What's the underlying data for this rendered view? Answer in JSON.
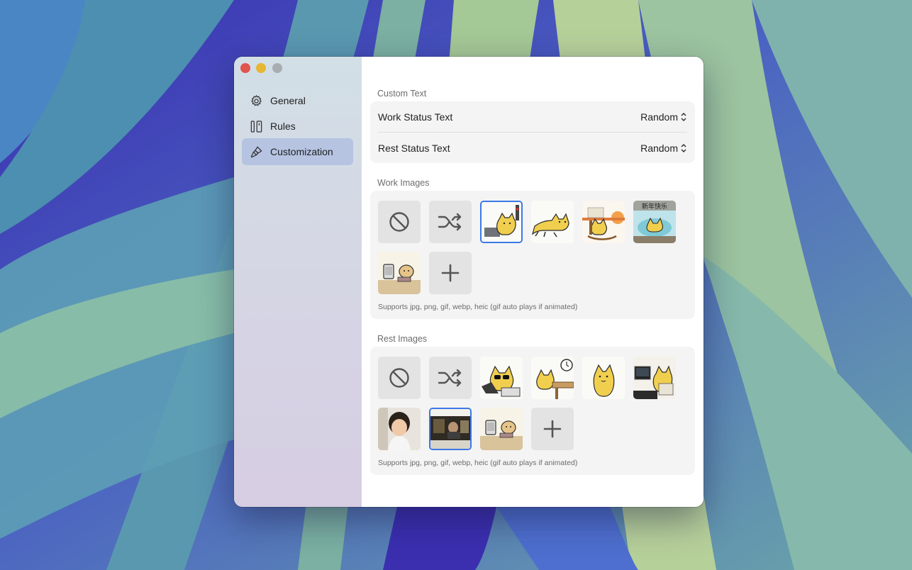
{
  "window": {
    "sidebar": {
      "items": [
        {
          "label": "General",
          "icon": "gear-icon"
        },
        {
          "label": "Rules",
          "icon": "rules-icon"
        },
        {
          "label": "Customization",
          "icon": "brush-icon",
          "selected": true
        }
      ]
    },
    "custom_text": {
      "title": "Custom Text",
      "rows": [
        {
          "label": "Work Status Text",
          "value": "Random"
        },
        {
          "label": "Rest Status Text",
          "value": "Random"
        }
      ]
    },
    "work_images": {
      "title": "Work Images",
      "tiles": [
        "none-icon",
        "shuffle-icon",
        "cat-laptop-image",
        "cat-running-image",
        "cat-rocking-chair-image",
        "cat-bath-image",
        "dog-computer-image",
        "add-icon"
      ],
      "selected_index": 2,
      "hint": "Supports jpg, png, gif, webp, heic (gif auto plays if animated)"
    },
    "rest_images": {
      "title": "Rest Images",
      "tiles": [
        "none-icon",
        "shuffle-icon",
        "cat-sunglasses-image",
        "cat-clock-desk-image",
        "cat-standing-image",
        "cat-monitor-image",
        "child-photo-image",
        "desk-photo-image",
        "dog-computer-image",
        "add-icon"
      ],
      "selected_index": 7,
      "hint": "Supports jpg, png, gif, webp, heic (gif auto plays if animated)"
    }
  },
  "colors": {
    "accent": "#3b78e7",
    "sidebar_selected": "#b6c4e2",
    "close": "#e2544c",
    "minimize": "#e6b730",
    "zoom_inactive": "#a9adb3"
  }
}
